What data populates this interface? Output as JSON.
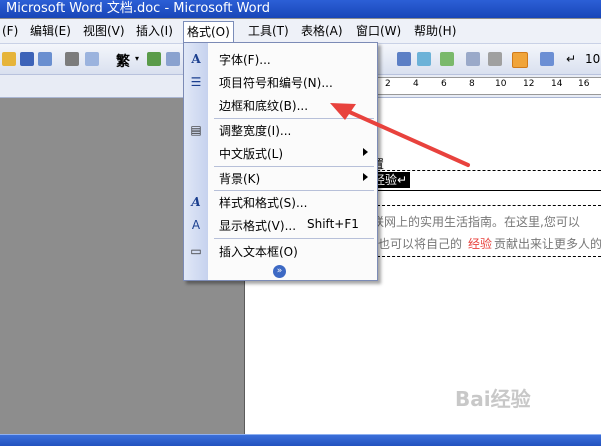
{
  "window": {
    "title": "Microsoft Word 文档.doc - Microsoft Word"
  },
  "menubar": {
    "items": [
      {
        "label": "(F)"
      },
      {
        "label": "编辑(E)"
      },
      {
        "label": "视图(V)"
      },
      {
        "label": "插入(I)"
      },
      {
        "label": "格式(O)"
      },
      {
        "label": "工具(T)"
      },
      {
        "label": "表格(A)"
      },
      {
        "label": "窗口(W)"
      },
      {
        "label": "帮助(H)"
      }
    ]
  },
  "toolbar": {
    "traditional_label": "繁",
    "zoom_partial": "10"
  },
  "ruler": {
    "ticks": [
      "2",
      "4",
      "6",
      "8",
      "10",
      "12",
      "14",
      "16"
    ]
  },
  "format_menu": {
    "items": [
      {
        "label": "字体(F)...",
        "icon": "font-A-icon"
      },
      {
        "label": "项目符号和编号(N)...",
        "icon": "bullets-icon"
      },
      {
        "label": "边框和底纹(B)..."
      },
      {
        "label": "调整宽度(I)...",
        "icon": "fit-width-icon"
      },
      {
        "label": "中文版式(L)",
        "submenu": true
      },
      {
        "label": "背景(K)",
        "submenu": true
      },
      {
        "label": "样式和格式(S)...",
        "icon": "styles-icon"
      },
      {
        "label": "显示格式(V)...",
        "shortcut": "Shift+F1",
        "icon": "reveal-format-icon"
      },
      {
        "label": "插入文本框(O)",
        "icon": "textbox-icon"
      }
    ],
    "more_glyph": "»"
  },
  "document": {
    "heading_fragment": "置",
    "selected_text": "经验↵",
    "line1": "联网上的实用生活指南。在这里,您可以",
    "line2_prefix": "也可以将自己的",
    "line2_highlight": "经验",
    "line2_suffix": "贡献出来让更多人的",
    "watermark": "Bai经验"
  },
  "colors": {
    "highlight_red": "#e8423d",
    "menu_border": "#7c8bb6",
    "title_blue": "#1846b8"
  }
}
